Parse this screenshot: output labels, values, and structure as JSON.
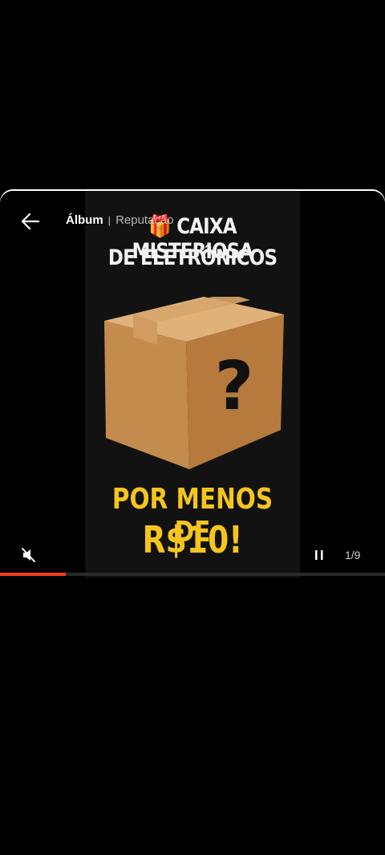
{
  "nav": {
    "tab_album": "Álbum",
    "tab_separator": "|",
    "tab_reputation": "Reputação"
  },
  "slide": {
    "title_line1": "🎁 CAIXA MISTERIOSA",
    "title_line2": "DE ELETRÔNICOS",
    "promo_line1": "POR MENOS DE",
    "promo_line2": "R$10!",
    "box_symbol": "?"
  },
  "player": {
    "counter": "1/9",
    "progress": 0.17,
    "muted": true,
    "playing": true
  },
  "icons": {
    "back": "arrow-left-icon",
    "mute": "speaker-muted-icon",
    "pause": "pause-icon"
  },
  "colors": {
    "promo": "#f5c51c",
    "progress": "#ff3b1a"
  }
}
